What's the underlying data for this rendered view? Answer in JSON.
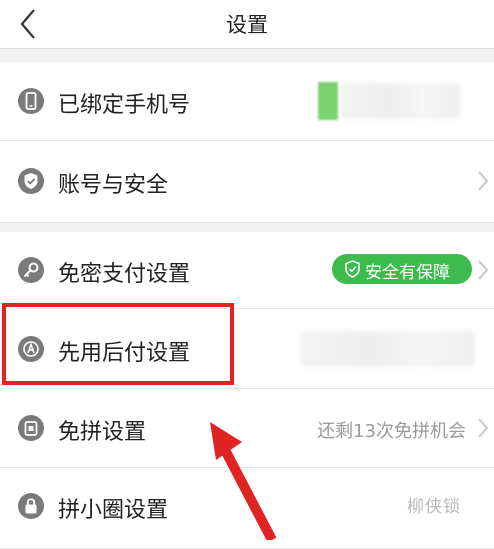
{
  "nav": {
    "title": "设置"
  },
  "rows": {
    "phone": {
      "label": "已绑定手机号",
      "icon": "phone-icon"
    },
    "account": {
      "label": "账号与安全",
      "icon": "shield-check-icon"
    },
    "payment": {
      "label": "免密支付设置",
      "icon": "key-icon",
      "badge": "安全有保障"
    },
    "pay_later": {
      "label": "先用后付设置",
      "icon": "pay-later-icon"
    },
    "group": {
      "label": "免拼设置",
      "icon": "group-buy-icon",
      "value": "还剩13次免拼机会"
    },
    "circle": {
      "label": "拼小圈设置",
      "icon": "lock-icon"
    }
  },
  "watermark": "柳侠锁",
  "colors": {
    "badge": "#3dbb4f",
    "highlight": "#e02423",
    "icon": "#7a7a7a"
  }
}
